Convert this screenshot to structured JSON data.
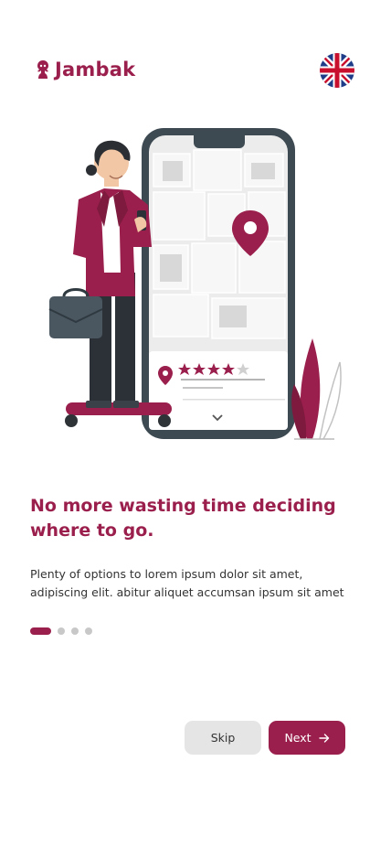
{
  "brand": {
    "name": "Jambak",
    "accent": "#9b1f4c"
  },
  "header": {
    "language_icon": "uk-flag-icon"
  },
  "onboarding": {
    "title": "No more wasting time deciding where to go.",
    "description": "Plenty of options to lorem ipsum dolor sit amet, adipiscing elit. abitur aliquet accumsan ipsum sit amet",
    "page_indicator": {
      "current": 1,
      "total": 4
    }
  },
  "actions": {
    "skip_label": "Skip",
    "next_label": "Next",
    "next_icon": "arrow-right-icon"
  }
}
